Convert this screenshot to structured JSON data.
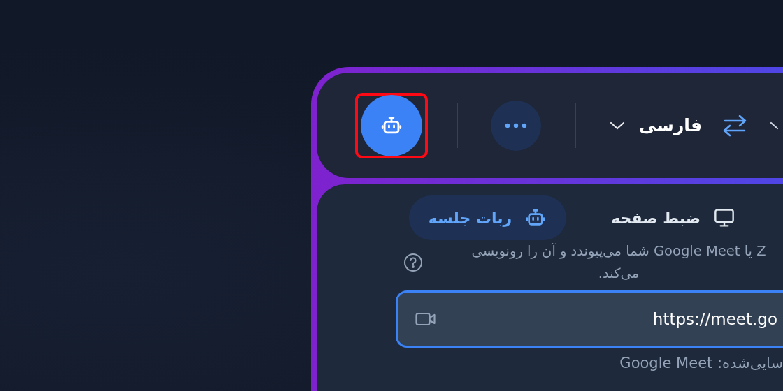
{
  "toolbar": {
    "bot_button": {
      "highlighted": true
    },
    "language": {
      "label": "فارسی"
    }
  },
  "tabs": [
    {
      "label": "ضبط صفحه",
      "kind": "screen",
      "selected": false
    },
    {
      "label": "ربات جلسه",
      "kind": "bot",
      "selected": true
    }
  ],
  "description": "Z یا Google Meet شما می‌پیوندد و آن را رونویسی می‌کند.",
  "meeting_link": {
    "value": "https://meet.go",
    "focused": true
  },
  "hint": "سایی‌شده: Google Meet"
}
